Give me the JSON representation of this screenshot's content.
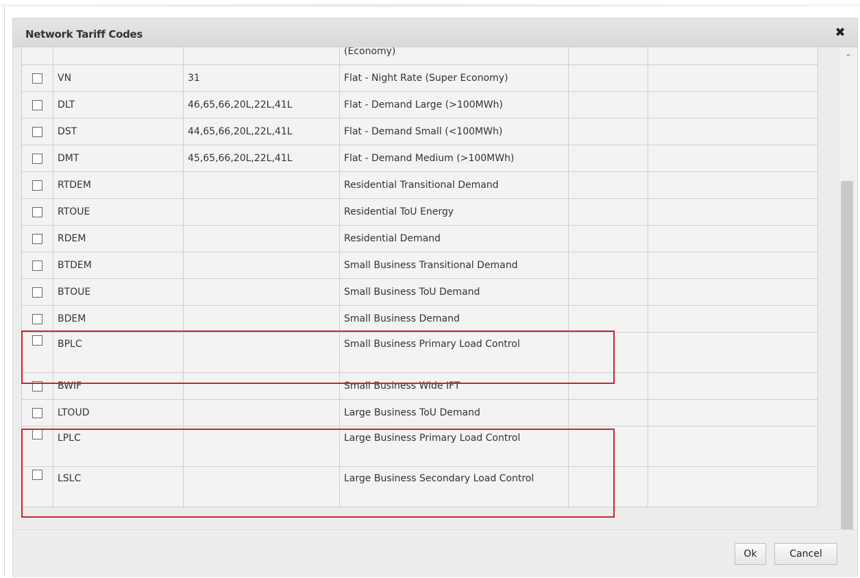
{
  "dialog": {
    "title": "Network Tariff Codes",
    "close_icon": "close-icon"
  },
  "rows": [
    {
      "code": "",
      "network_codes": "",
      "description": "(Economy)",
      "height": "single"
    },
    {
      "code": "VN",
      "network_codes": "31",
      "description": "Flat - Night Rate (Super Economy)",
      "height": "single"
    },
    {
      "code": "DLT",
      "network_codes": "46,65,66,20L,22L,41L",
      "description": "Flat - Demand Large (>100MWh)",
      "height": "single"
    },
    {
      "code": "DST",
      "network_codes": "44,65,66,20L,22L,41L",
      "description": "Flat - Demand Small (<100MWh)",
      "height": "single"
    },
    {
      "code": "DMT",
      "network_codes": "45,65,66,20L,22L,41L",
      "description": "Flat - Demand Medium (>100MWh)",
      "height": "single"
    },
    {
      "code": "RTDEM",
      "network_codes": "",
      "description": "Residential Transitional Demand",
      "height": "single"
    },
    {
      "code": "RTOUE",
      "network_codes": "",
      "description": "Residential ToU Energy",
      "height": "single"
    },
    {
      "code": "RDEM",
      "network_codes": "",
      "description": "Residential Demand",
      "height": "single"
    },
    {
      "code": "BTDEM",
      "network_codes": "",
      "description": "Small Business Transitional Demand",
      "height": "single"
    },
    {
      "code": "BTOUE",
      "network_codes": "",
      "description": "Small Business ToU Demand",
      "height": "single"
    },
    {
      "code": "BDEM",
      "network_codes": "",
      "description": "Small Business Demand",
      "height": "single"
    },
    {
      "code": "BPLC",
      "network_codes": "",
      "description": "Small Business Primary Load Control",
      "height": "double"
    },
    {
      "code": "BWIF",
      "network_codes": "",
      "description": "Small Business Wide IFT",
      "height": "single"
    },
    {
      "code": "LTOUD",
      "network_codes": "",
      "description": "Large Business ToU Demand",
      "height": "single"
    },
    {
      "code": "LPLC",
      "network_codes": "",
      "description": "Large Business Primary Load Control",
      "height": "double"
    },
    {
      "code": "LSLC",
      "network_codes": "",
      "description": "Large Business Secondary Load Control",
      "height": "double"
    }
  ],
  "buttons": {
    "ok": "Ok",
    "cancel": "Cancel"
  },
  "scrollbar": {
    "up_icon": "chevron-up-icon",
    "down_icon": "chevron-down-icon"
  },
  "colors": {
    "highlight": "#c0282c",
    "grid_line": "#cfcfcf",
    "dialog_bg": "#ececec"
  }
}
